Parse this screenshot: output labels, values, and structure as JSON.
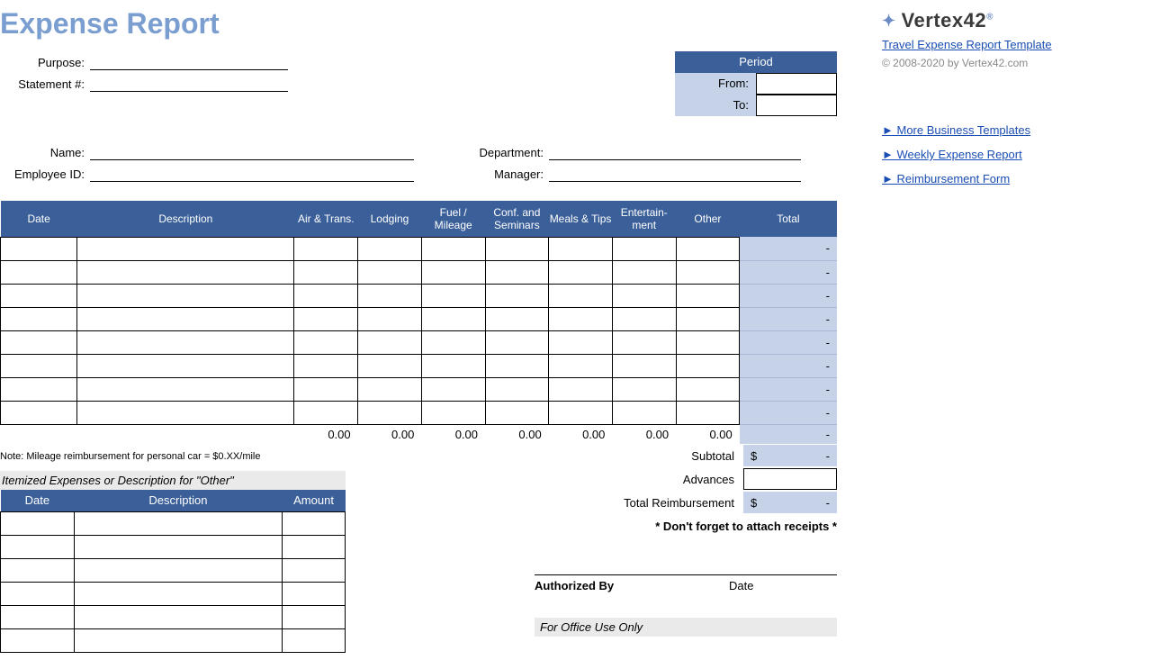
{
  "title": "Expense Report",
  "labels": {
    "purpose": "Purpose:",
    "statement": "Statement #:",
    "name": "Name:",
    "employee": "Employee ID:",
    "department": "Department:",
    "manager": "Manager:"
  },
  "period": {
    "header": "Period",
    "from": "From:",
    "to": "To:"
  },
  "table": {
    "headers": {
      "date": "Date",
      "description": "Description",
      "air": "Air & Trans.",
      "lodging": "Lodging",
      "fuel": "Fuel / Mileage",
      "conf": "Conf. and Seminars",
      "meals": "Meals & Tips",
      "ent": "Entertain-ment",
      "other": "Other",
      "total": "Total"
    },
    "rows_dash": "-",
    "sums": [
      "0.00",
      "0.00",
      "0.00",
      "0.00",
      "0.00",
      "0.00",
      "0.00"
    ],
    "sumtotal": "-"
  },
  "note": "Note: Mileage reimbursement for personal car = $0.XX/mile",
  "itemized": {
    "title": "Itemized Expenses or Description for \"Other\"",
    "headers": {
      "date": "Date",
      "description": "Description",
      "amount": "Amount"
    }
  },
  "summary": {
    "subtotal_label": "Subtotal",
    "subtotal_value_prefix": "$",
    "subtotal_value": "-",
    "advances_label": "Advances",
    "advances_value": "",
    "total_label": "Total Reimbursement",
    "total_value_prefix": "$",
    "total_value": "-",
    "receipt_note": "* Don't forget to attach receipts *"
  },
  "signature": {
    "authorized": "Authorized By",
    "date": "Date",
    "office": "For Office Use Only"
  },
  "sidebar": {
    "logo": "Vertex42",
    "template_link": "Travel Expense Report Template",
    "copyright": "© 2008-2020 by Vertex42.com",
    "links": [
      "More Business Templates",
      "Weekly Expense Report",
      "Reimbursement Form"
    ]
  }
}
